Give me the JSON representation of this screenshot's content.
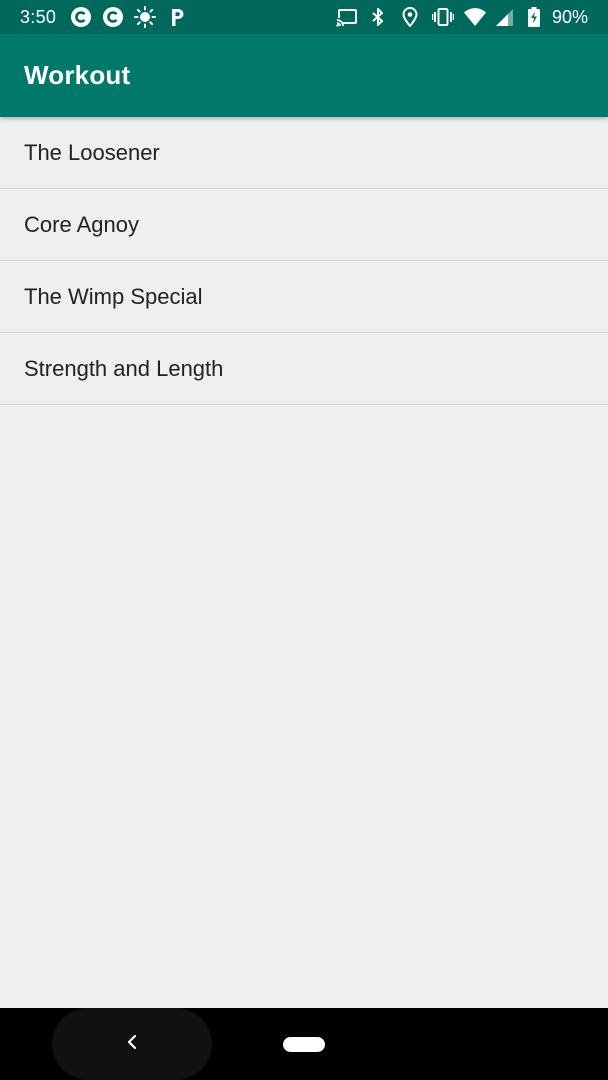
{
  "status_bar": {
    "time": "3:50",
    "battery_percent": "90%",
    "notification_icons": [
      "c-circle-icon",
      "c-circle-icon",
      "brightness-icon",
      "p-icon"
    ],
    "system_icons": [
      "cast-icon",
      "bluetooth-icon",
      "location-icon",
      "vibrate-icon",
      "wifi-icon",
      "cell-signal-icon",
      "battery-charging-icon"
    ]
  },
  "app_bar": {
    "title": "Workout"
  },
  "workouts": [
    {
      "label": "The Loosener"
    },
    {
      "label": "Core Agnoy"
    },
    {
      "label": "The Wimp Special"
    },
    {
      "label": "Strength and Length"
    }
  ],
  "colors": {
    "status_bar": "#00695c",
    "app_bar": "#00796b",
    "background": "#efefef",
    "divider": "#d2d2d2"
  }
}
